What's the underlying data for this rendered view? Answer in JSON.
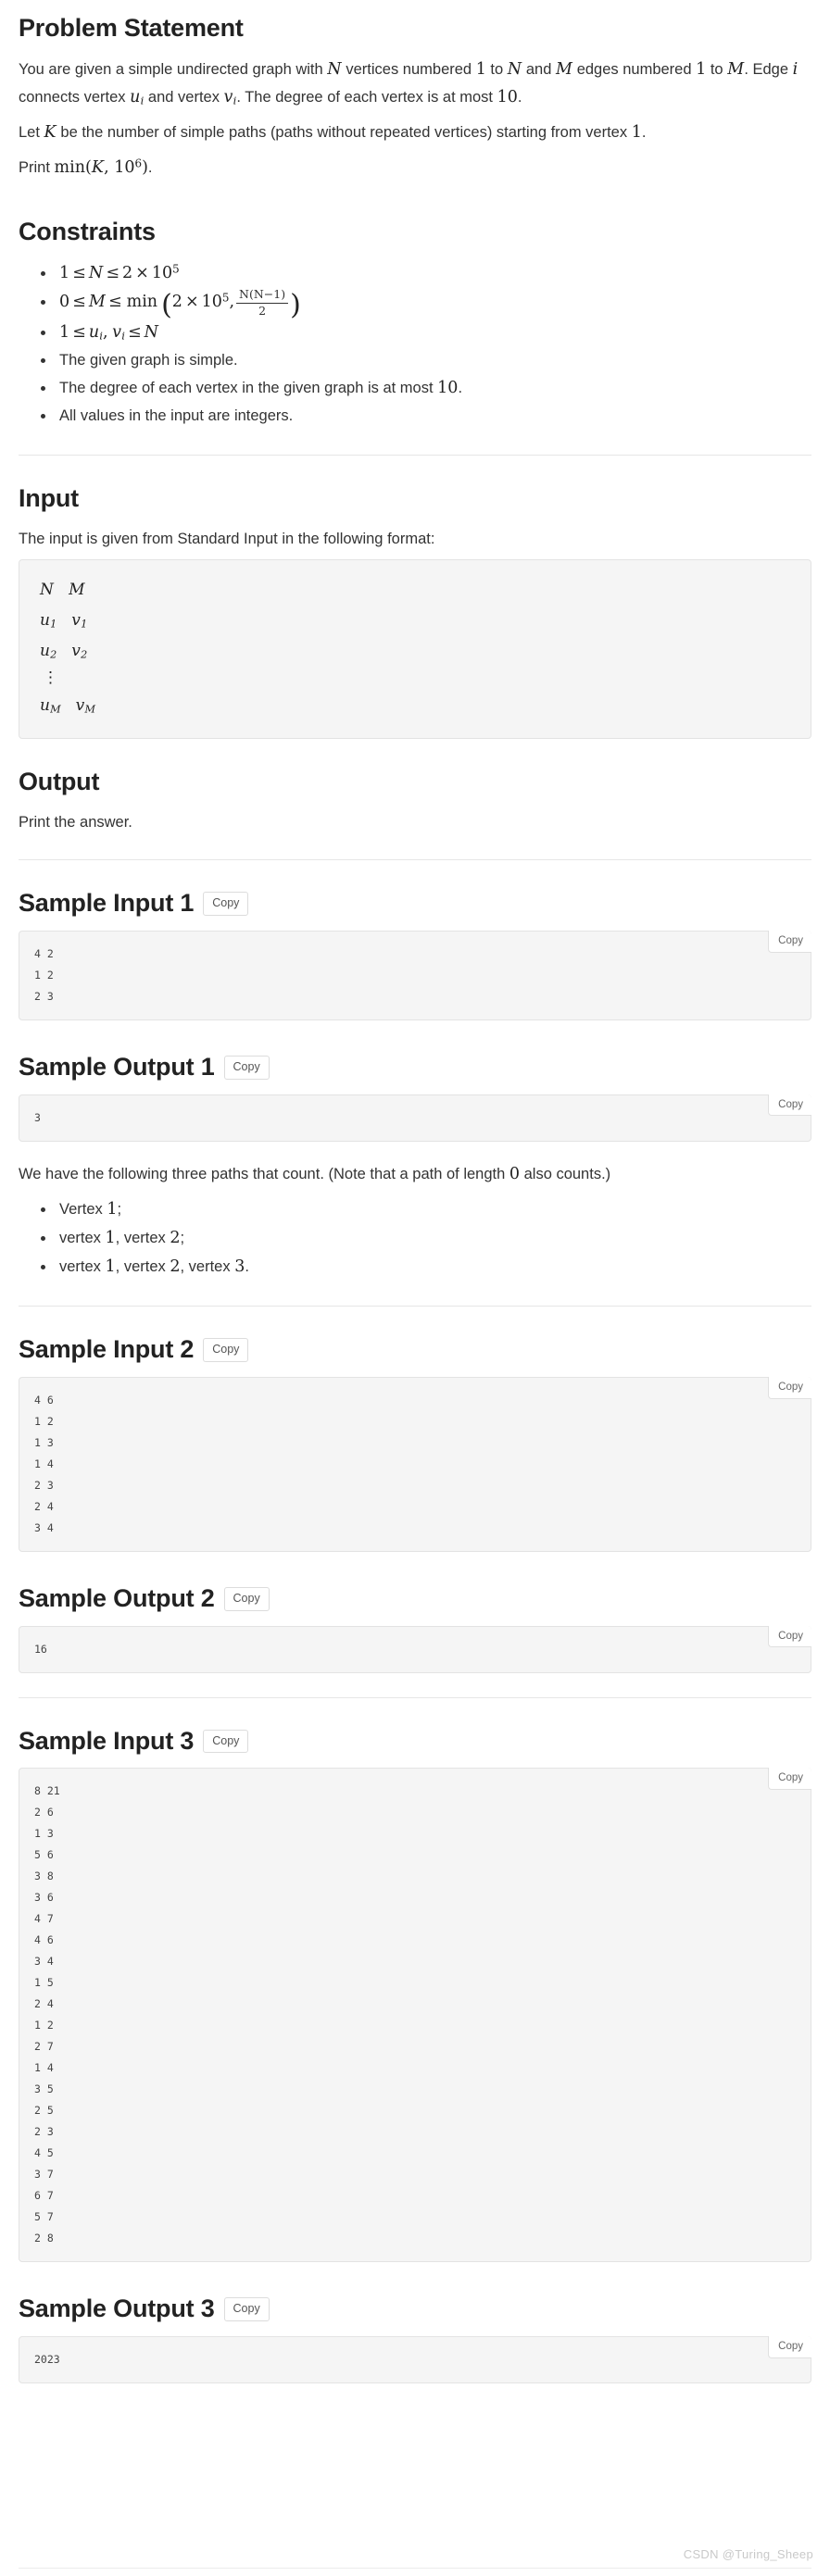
{
  "sections": {
    "problem_statement": {
      "title": "Problem Statement",
      "line1_a": "You are given a simple undirected graph with ",
      "line1_N": "N",
      "line1_b": " vertices numbered ",
      "line1_1": "1",
      "line1_c": " to ",
      "line1_N2": "N",
      "line1_d": " and ",
      "line1_M": "M",
      "line1_e": " edges numbered ",
      "line1_1b": "1",
      "line1_f": " to ",
      "line1_M2": "M",
      "line1_g": ". Edge ",
      "line1_i": "i",
      "line1_h": " connects vertex ",
      "line1_ui": "u",
      "line1_ui_sub": "i",
      "line1_j": " and vertex ",
      "line1_vi": "v",
      "line1_vi_sub": "i",
      "line1_k": ". The degree of each vertex is at most ",
      "line1_10": "10",
      "line1_l": ".",
      "line2_a": "Let ",
      "line2_K": "K",
      "line2_b": " be the number of simple paths (paths without repeated vertices) starting from vertex ",
      "line2_1": "1",
      "line2_c": ".",
      "line3_a": "Print ",
      "line3_min": "min",
      "line3_open": "(",
      "line3_K": "K",
      "line3_comma": ", ",
      "line3_base": "10",
      "line3_exp": "6",
      "line3_close": ")",
      "line3_end": "."
    },
    "constraints": {
      "title": "Constraints",
      "items": [
        {
          "kind": "math",
          "text": "1 ≤ N ≤ 2 × 10^5"
        },
        {
          "kind": "math",
          "text": "0 ≤ M ≤ min(2 × 10^5, N(N−1)/2)"
        },
        {
          "kind": "math",
          "text": "1 ≤ u_i, v_i ≤ N"
        },
        {
          "kind": "text",
          "text": "The given graph is simple."
        },
        {
          "kind": "mixed",
          "text": "The degree of each vertex in the given graph is at most 10."
        },
        {
          "kind": "text",
          "text": "All values in the input are integers."
        }
      ],
      "c1": {
        "one": "1",
        "le1": "≤",
        "N": "N",
        "le2": "≤",
        "two": "2",
        "times": "×",
        "base": "10",
        "exp": "5"
      },
      "c2": {
        "zero": "0",
        "le1": "≤",
        "M": "M",
        "le2": "≤",
        "min": "min",
        "two": "2",
        "times": "×",
        "base": "10",
        "exp": "5",
        "comma": ",",
        "num": "N(N−1)",
        "den": "2"
      },
      "c3": {
        "one": "1",
        "le1": "≤",
        "u": "u",
        "usub": "i",
        "comma": ",",
        "v": "v",
        "vsub": "i",
        "le2": "≤",
        "N": "N"
      },
      "c4": "The given graph is simple.",
      "c5_a": "The degree of each vertex in the given graph is at most ",
      "c5_n": "10",
      "c5_b": ".",
      "c6": "All values in the input are integers."
    },
    "input": {
      "title": "Input",
      "description": "The input is given from Standard Input in the following format:",
      "format_rows": [
        {
          "left": "N",
          "right": "M",
          "sub_left": "",
          "sub_right": ""
        },
        {
          "left": "u",
          "right": "v",
          "sub_left": "1",
          "sub_right": "1"
        },
        {
          "left": "u",
          "right": "v",
          "sub_left": "2",
          "sub_right": "2"
        },
        {
          "left": "⋮",
          "right": "",
          "sub_left": "",
          "sub_right": ""
        },
        {
          "left": "u",
          "right": "v",
          "sub_left": "M",
          "sub_right": "M"
        }
      ]
    },
    "output": {
      "title": "Output",
      "description": "Print the answer."
    },
    "sample_input_1": {
      "title": "Sample Input 1",
      "copy_label": "Copy",
      "code_copy_label": "Copy",
      "code": "4 2\n1 2\n2 3"
    },
    "sample_output_1": {
      "title": "Sample Output 1",
      "copy_label": "Copy",
      "code_copy_label": "Copy",
      "code": "3",
      "explanation_a": "We have the following three paths that count. (Note that a path of length ",
      "explanation_n": "0",
      "explanation_b": " also counts.)",
      "paths": [
        {
          "pre": "Vertex ",
          "n1": "1",
          "mid": "",
          "n2": "",
          "mid2": "",
          "n3": "",
          "end": ";"
        },
        {
          "pre": "vertex ",
          "n1": "1",
          "mid": ", vertex ",
          "n2": "2",
          "mid2": "",
          "n3": "",
          "end": ";"
        },
        {
          "pre": "vertex ",
          "n1": "1",
          "mid": ", vertex ",
          "n2": "2",
          "mid2": ", vertex ",
          "n3": "3",
          "end": "."
        }
      ]
    },
    "sample_input_2": {
      "title": "Sample Input 2",
      "copy_label": "Copy",
      "code_copy_label": "Copy",
      "code": "4 6\n1 2\n1 3\n1 4\n2 3\n2 4\n3 4"
    },
    "sample_output_2": {
      "title": "Sample Output 2",
      "copy_label": "Copy",
      "code_copy_label": "Copy",
      "code": "16"
    },
    "sample_input_3": {
      "title": "Sample Input 3",
      "copy_label": "Copy",
      "code_copy_label": "Copy",
      "code": "8 21\n2 6\n1 3\n5 6\n3 8\n3 6\n4 7\n4 6\n3 4\n1 5\n2 4\n1 2\n2 7\n1 4\n3 5\n2 5\n2 3\n4 5\n3 7\n6 7\n5 7\n2 8"
    },
    "sample_output_3": {
      "title": "Sample Output 3",
      "copy_label": "Copy",
      "code_copy_label": "Copy",
      "code": "2023"
    }
  },
  "watermark": "CSDN @Turing_Sheep"
}
